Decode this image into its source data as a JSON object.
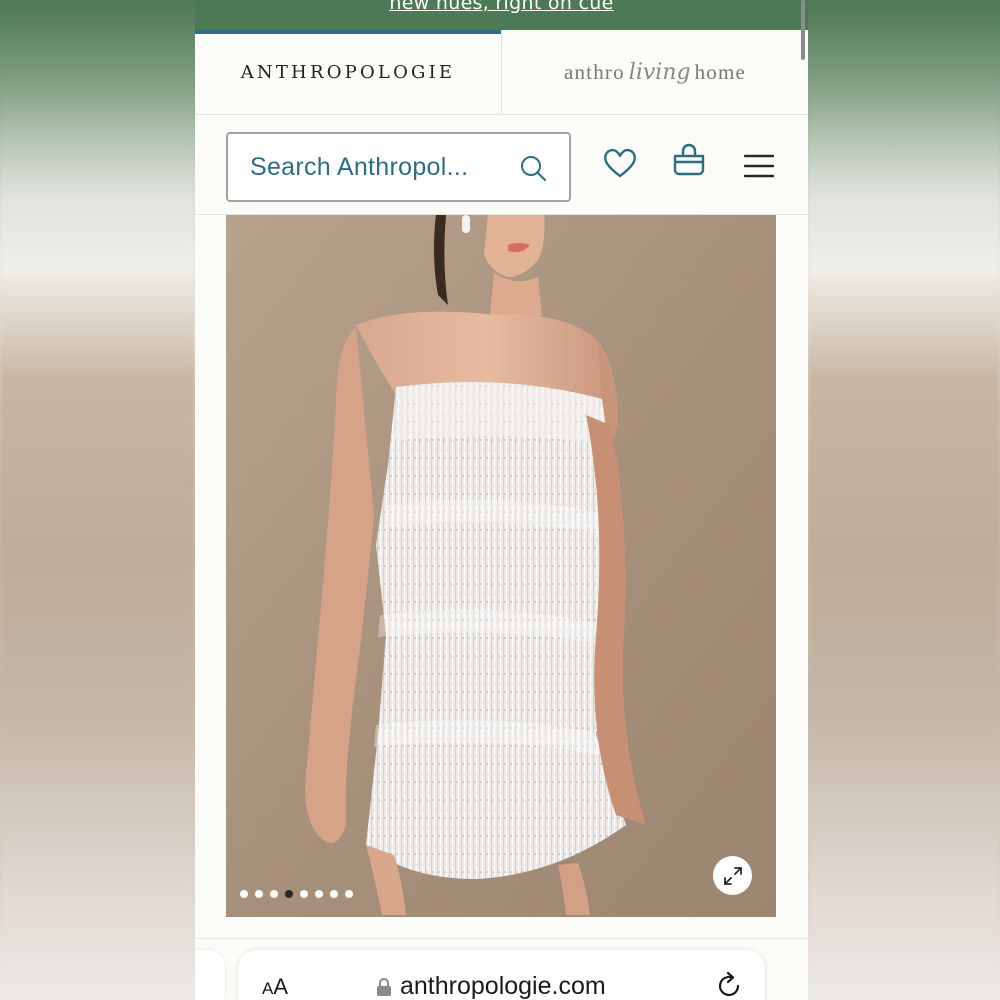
{
  "promo": {
    "link_text": "new hues, right on cue"
  },
  "brand_tabs": {
    "anthropologie": "ANTHROPOLOGIE",
    "living_prefix": "anthro",
    "living_script": "living",
    "living_suffix": "home"
  },
  "search": {
    "placeholder": "Search Anthropol..."
  },
  "header_icons": [
    "heart-icon",
    "shopping-bag-icon",
    "hamburger-menu-icon"
  ],
  "gallery": {
    "image_count": 8,
    "active_index": 3,
    "expand_icon": "expand-arrows-icon"
  },
  "browser": {
    "text_size_label_small": "A",
    "text_size_label_large": "A",
    "url": "anthropologie.com",
    "lock_icon": "lock-icon",
    "reload_icon": "reload-icon"
  },
  "colors": {
    "promo_green": "#4c7a57",
    "accent_teal": "#2d7289",
    "search_text": "#2d6d84"
  }
}
